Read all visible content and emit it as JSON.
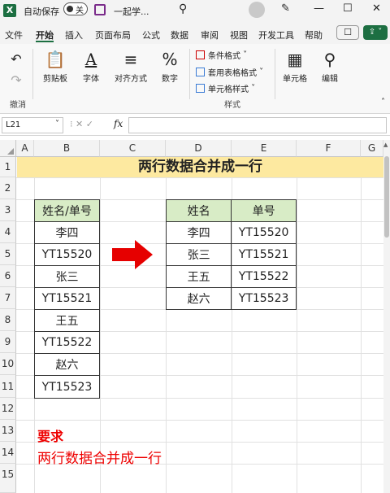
{
  "titlebar": {
    "logo": "X",
    "autosave_label": "自动保存",
    "toggle_state": "关",
    "doc_title": "一起学...",
    "search_icon": "search-icon",
    "minimize": "—",
    "maximize": "☐",
    "close": "✕"
  },
  "menu": {
    "items": [
      "文件",
      "开始",
      "插入",
      "页面布局",
      "公式",
      "数据",
      "审阅",
      "视图",
      "开发工具",
      "帮助"
    ],
    "active": "开始"
  },
  "ribbon": {
    "undo_group": "撤消",
    "clipboard": "剪贴板",
    "font": "字体",
    "align": "对齐方式",
    "number": "数字",
    "cond_format": "条件格式",
    "table_format": "套用表格格式",
    "cell_style": "单元格样式",
    "styles_group": "样式",
    "cells": "单元格",
    "edit": "编辑"
  },
  "formula_bar": {
    "name_box": "L21",
    "fx": "fx",
    "formula": ""
  },
  "columns": [
    "A",
    "B",
    "C",
    "D",
    "E",
    "F",
    "G"
  ],
  "rows": [
    "1",
    "2",
    "3",
    "4",
    "5",
    "6",
    "7",
    "8",
    "9",
    "10",
    "11",
    "12",
    "13",
    "14",
    "15"
  ],
  "sheet": {
    "title": "两行数据合并成一行",
    "left_table": [
      "姓名/单号",
      "李四",
      "YT15520",
      "张三",
      "YT15521",
      "王五",
      "YT15522",
      "赵六",
      "YT15523"
    ],
    "right_header": [
      "姓名",
      "单号"
    ],
    "right_rows": [
      [
        "李四",
        "YT15520"
      ],
      [
        "张三",
        "YT15521"
      ],
      [
        "王五",
        "YT15522"
      ],
      [
        "赵六",
        "YT15523"
      ]
    ],
    "req_title": "要求",
    "req_text": "两行数据合并成一行"
  },
  "colors": {
    "accent": "#1d6f42",
    "title_fill": "#fde9a0",
    "header_fill": "#d8ecc6",
    "arrow": "#e60000",
    "req_text": "#e00000"
  }
}
